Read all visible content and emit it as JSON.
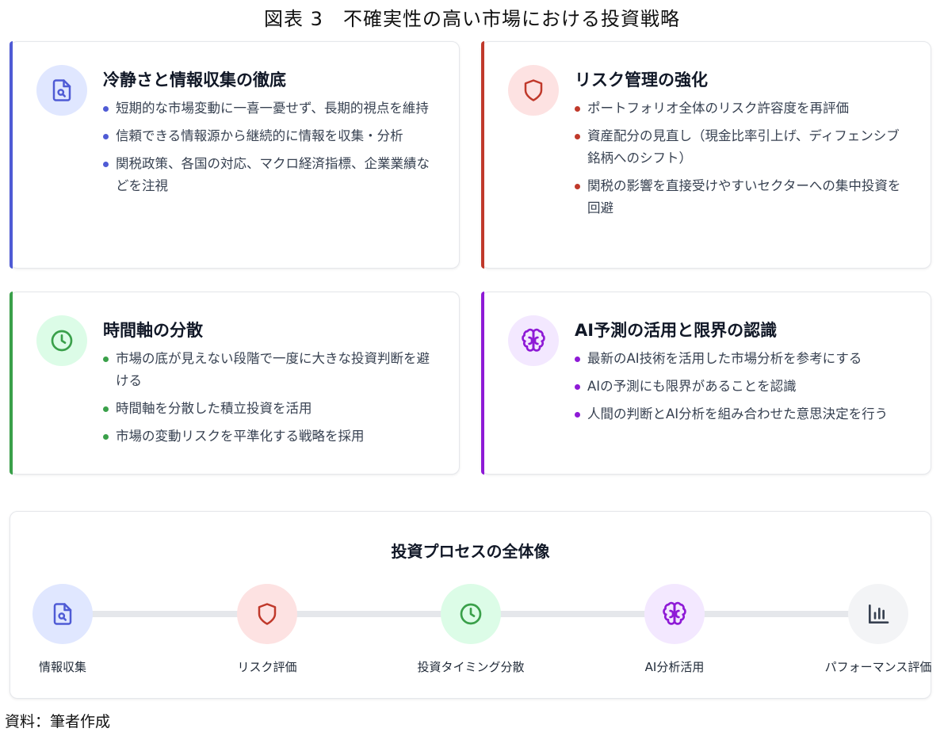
{
  "title": "図表 3　不確実性の高い市場における投資戦略",
  "cards": [
    {
      "title": "冷静さと情報収集の徹底",
      "accent": "#4f5bd5",
      "icon_bg": "#e0e7ff",
      "icon": "document-search-icon",
      "items": [
        "短期的な市場変動に一喜一憂せず、長期的視点を維持",
        "信頼できる情報源から継続的に情報を収集・分析",
        "関税政策、各国の対応、マクロ経済指標、企業業績などを注視"
      ]
    },
    {
      "title": "リスク管理の強化",
      "accent": "#c0392b",
      "icon_bg": "#fde2e2",
      "icon": "shield-icon",
      "items": [
        "ポートフォリオ全体のリスク許容度を再評価",
        "資産配分の見直し（現金比率引上げ、ディフェンシブ銘柄へのシフト）",
        "関税の影響を直接受けやすいセクターへの集中投資を回避"
      ]
    },
    {
      "title": "時間軸の分散",
      "accent": "#3aa04a",
      "icon_bg": "#dcfce7",
      "icon": "clock-icon",
      "items": [
        "市場の底が見えない段階で一度に大きな投資判断を避ける",
        "時間軸を分散した積立投資を活用",
        "市場の変動リスクを平準化する戦略を採用"
      ]
    },
    {
      "title": "AI予測の活用と限界の認識",
      "accent": "#8e1ad6",
      "icon_bg": "#f3e8ff",
      "icon": "brain-icon",
      "items": [
        "最新のAI技術を活用した市場分析を参考にする",
        "AIの予測にも限界があることを認識",
        "人間の判断とAI分析を組み合わせた意思決定を行う"
      ]
    }
  ],
  "process": {
    "title": "投資プロセスの全体像",
    "steps": [
      {
        "label": "情報収集",
        "icon": "document-search-icon",
        "color": "#4f5bd5",
        "bg": "#e0e7ff"
      },
      {
        "label": "リスク評価",
        "icon": "shield-icon",
        "color": "#c0392b",
        "bg": "#fde2e2"
      },
      {
        "label": "投資タイミング分散",
        "icon": "clock-icon",
        "color": "#3aa04a",
        "bg": "#dcfce7"
      },
      {
        "label": "AI分析活用",
        "icon": "brain-icon",
        "color": "#8e1ad6",
        "bg": "#f3e8ff"
      },
      {
        "label": "パフォーマンス評価",
        "icon": "bar-chart-icon",
        "color": "#374151",
        "bg": "#f3f4f6"
      }
    ]
  },
  "source": "資料：筆者作成"
}
